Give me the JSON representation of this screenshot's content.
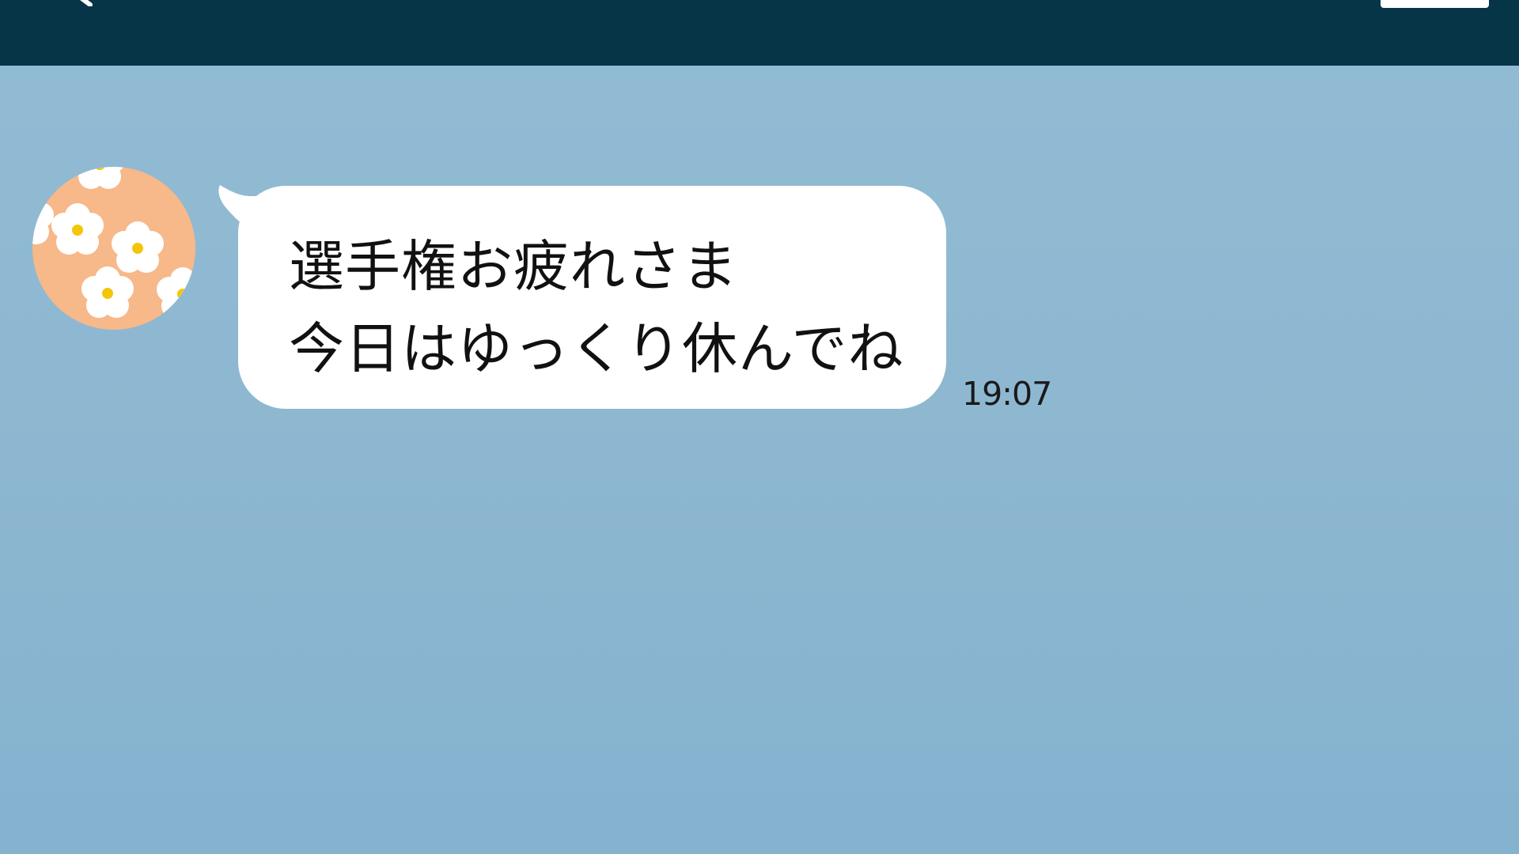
{
  "header": {
    "back_icon": "chevron-left-icon",
    "action_button_label": ""
  },
  "message": {
    "avatar": "flower-pattern-avatar",
    "lines": [
      "選手権お疲れさま",
      "今日はゆっくり休んでね"
    ],
    "time": "19:07",
    "bubble_color": "#ffffff"
  },
  "colors": {
    "header_bg": "#063547",
    "chat_bg": "#8fb9d2",
    "avatar_bg": "#f7b88a",
    "flower_petal": "#ffffff",
    "flower_center": "#f4c60a"
  }
}
